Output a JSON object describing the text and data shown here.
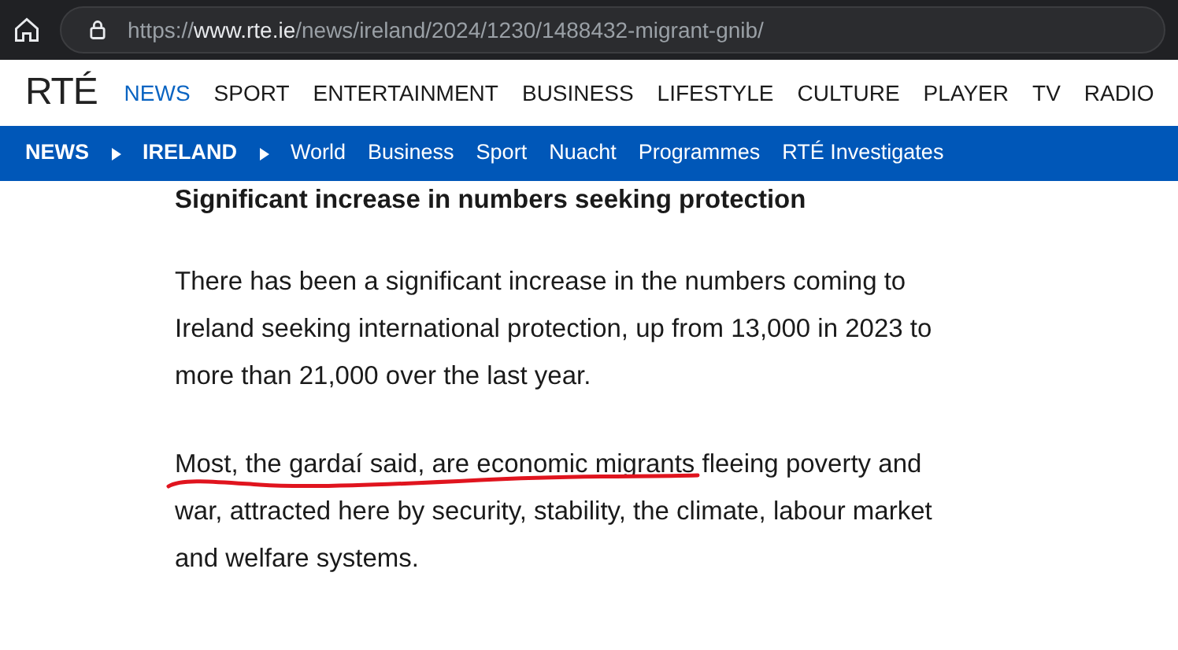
{
  "browser": {
    "url_scheme": "https://",
    "url_host": "www.rte.ie",
    "url_path": "/news/ireland/2024/1230/1488432-migrant-gnib/"
  },
  "site_nav": {
    "logo": "RTÉ",
    "items": [
      {
        "label": "NEWS",
        "selected": true
      },
      {
        "label": "SPORT",
        "selected": false
      },
      {
        "label": "ENTERTAINMENT",
        "selected": false
      },
      {
        "label": "BUSINESS",
        "selected": false
      },
      {
        "label": "LIFESTYLE",
        "selected": false
      },
      {
        "label": "CULTURE",
        "selected": false
      },
      {
        "label": "PLAYER",
        "selected": false
      },
      {
        "label": "TV",
        "selected": false
      },
      {
        "label": "RADIO",
        "selected": false
      }
    ]
  },
  "section_nav": {
    "breadcrumbs": [
      "NEWS",
      "IRELAND"
    ],
    "links": [
      "World",
      "Business",
      "Sport",
      "Nuacht",
      "Programmes",
      "RTÉ Investigates"
    ]
  },
  "article": {
    "heading": "Significant increase in numbers seeking protection",
    "paragraphs": [
      {
        "text": "There has been a significant increase in the numbers coming to Ireland seeking international protection, up from 13,000 in 2023 to more than 21,000 over the last year.",
        "underlined": false
      },
      {
        "text": "Most, the gardaí said, are economic migrants fleeing poverty and war, attracted here by security, stability, the climate, labour market and welfare systems.",
        "underlined": true
      }
    ]
  }
}
